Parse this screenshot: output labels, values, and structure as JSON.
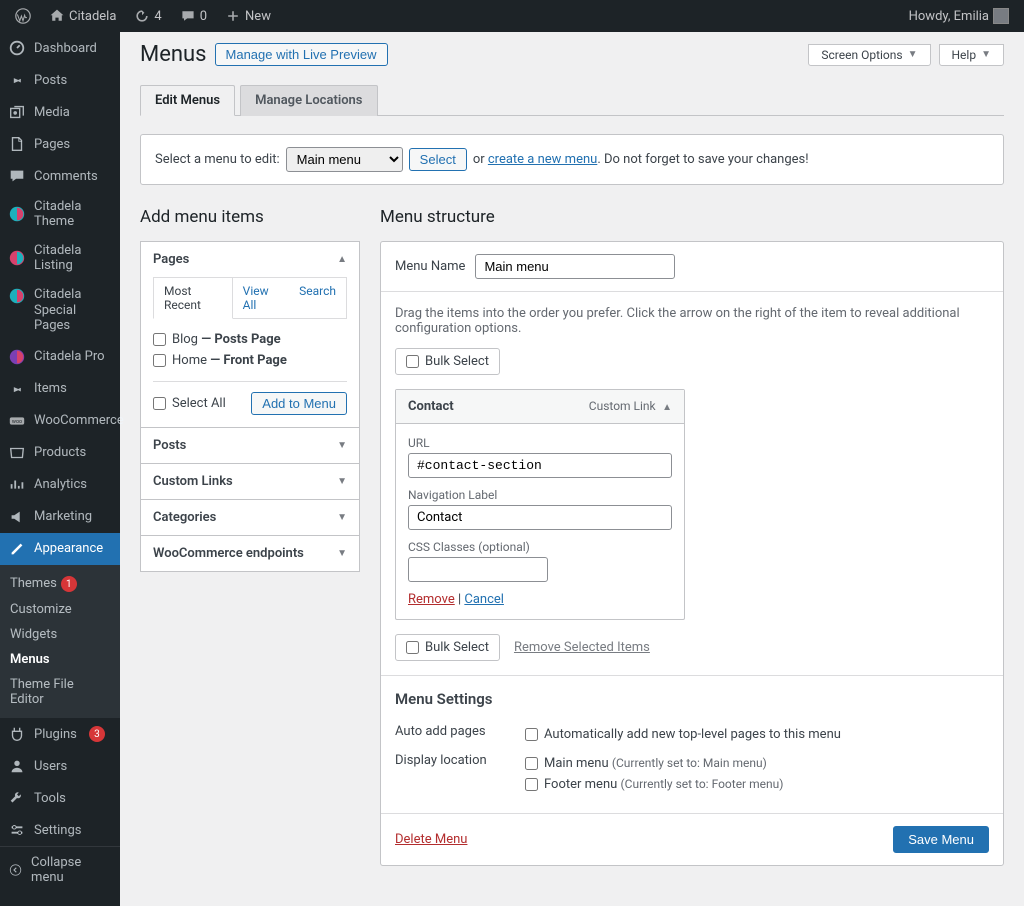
{
  "adminbar": {
    "site_name": "Citadela",
    "updates": "4",
    "comments": "0",
    "new": "New",
    "howdy": "Howdy, Emilia"
  },
  "sidebar": {
    "items": [
      {
        "label": "Dashboard"
      },
      {
        "label": "Posts"
      },
      {
        "label": "Media"
      },
      {
        "label": "Pages"
      },
      {
        "label": "Comments"
      },
      {
        "label": "Citadela Theme"
      },
      {
        "label": "Citadela Listing"
      },
      {
        "label": "Citadela Special Pages"
      },
      {
        "label": "Citadela Pro"
      },
      {
        "label": "Items"
      },
      {
        "label": "WooCommerce"
      },
      {
        "label": "Products"
      },
      {
        "label": "Analytics"
      },
      {
        "label": "Marketing"
      },
      {
        "label": "Appearance"
      },
      {
        "label": "Plugins"
      },
      {
        "label": "Users"
      },
      {
        "label": "Tools"
      },
      {
        "label": "Settings"
      }
    ],
    "themes_badge": "1",
    "plugins_badge": "3",
    "submenu": [
      "Themes",
      "Customize",
      "Widgets",
      "Menus",
      "Theme File Editor"
    ],
    "collapse": "Collapse menu"
  },
  "header": {
    "title": "Menus",
    "live_preview": "Manage with Live Preview",
    "screen_options": "Screen Options",
    "help": "Help"
  },
  "tabs": {
    "edit": "Edit Menus",
    "locations": "Manage Locations"
  },
  "select_bar": {
    "label": "Select a menu to edit:",
    "selected": "Main menu",
    "select_btn": "Select",
    "or": "or",
    "create": "create a new menu",
    "suffix": ". Do not forget to save your changes!"
  },
  "left": {
    "heading": "Add menu items",
    "pages": "Pages",
    "tabs": {
      "recent": "Most Recent",
      "all": "View All",
      "search": "Search"
    },
    "items": [
      {
        "name": "Blog",
        "suffix": "— Posts Page"
      },
      {
        "name": "Home",
        "suffix": "— Front Page"
      }
    ],
    "select_all": "Select All",
    "add": "Add to Menu",
    "posts": "Posts",
    "custom_links": "Custom Links",
    "categories": "Categories",
    "woo": "WooCommerce endpoints"
  },
  "right": {
    "heading": "Menu structure",
    "name_label": "Menu Name",
    "name_value": "Main menu",
    "hint": "Drag the items into the order you prefer. Click the arrow on the right of the item to reveal additional configuration options.",
    "bulk": "Bulk Select",
    "item": {
      "title": "Contact",
      "type": "Custom Link",
      "url_label": "URL",
      "url": "#contact-section",
      "nav_label": "Navigation Label",
      "nav_value": "Contact",
      "css_label": "CSS Classes (optional)",
      "css_value": "",
      "remove": "Remove",
      "cancel": "Cancel"
    },
    "remove_selected": "Remove Selected Items",
    "settings": {
      "heading": "Menu Settings",
      "auto_label": "Auto add pages",
      "auto_check": "Automatically add new top-level pages to this menu",
      "display_label": "Display location",
      "main": "Main menu",
      "main_hint": "(Currently set to: Main menu)",
      "footer": "Footer menu",
      "footer_hint": "(Currently set to: Footer menu)"
    },
    "delete": "Delete Menu",
    "save": "Save Menu"
  }
}
